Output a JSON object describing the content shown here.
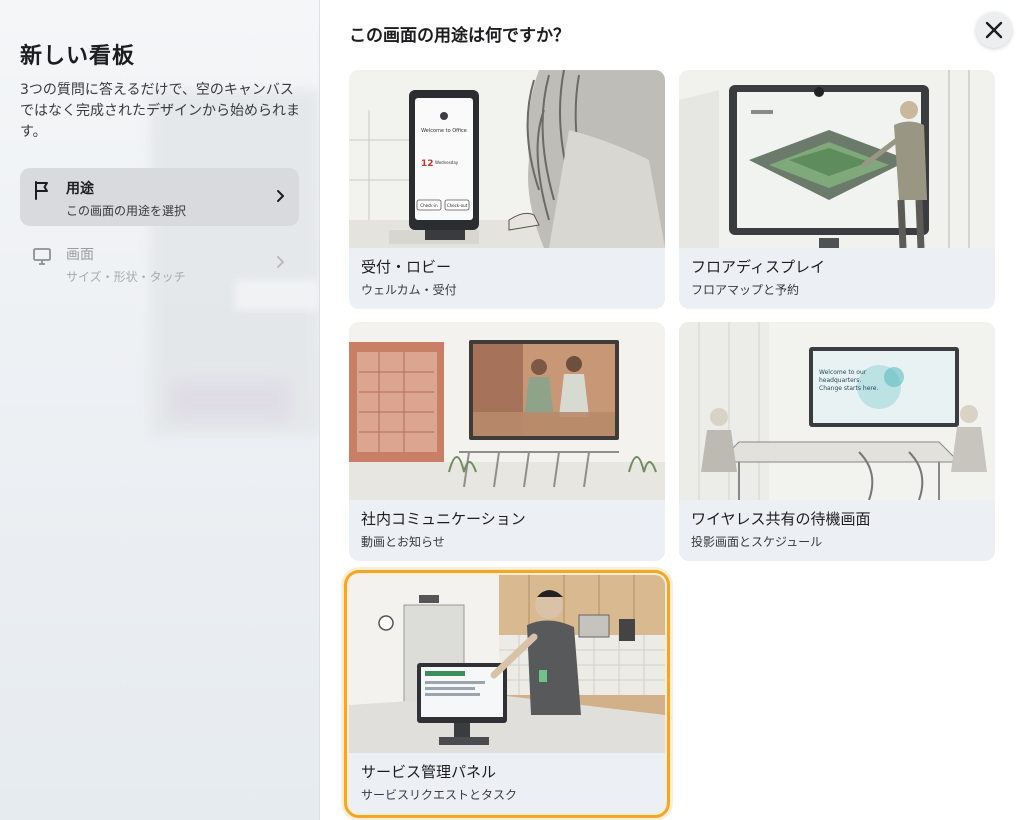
{
  "sidebar": {
    "title": "新しい看板",
    "description": "3つの質問に答えるだけで、空のキャンバスではなく完成されたデザインから始められます。",
    "steps": [
      {
        "label": "用途",
        "sub": "この画面の用途を選択",
        "icon": "flag-icon",
        "state": "active"
      },
      {
        "label": "画面",
        "sub": "サイズ・形状・タッチ",
        "icon": "monitor-icon",
        "state": "inactive"
      }
    ]
  },
  "main": {
    "title": "この画面の用途は何ですか？",
    "close_icon": "close-icon",
    "cards": [
      {
        "title": "受付・ロビー",
        "sub": "ウェルカム・受付",
        "kiosk_text": [
          "Welcome to Office",
          "12",
          "Wednesday",
          "Check-in",
          "Check-out"
        ]
      },
      {
        "title": "フロアディスプレイ",
        "sub": "フロアマップと予約"
      },
      {
        "title": "社内コミュニケーション",
        "sub": "動画とお知らせ"
      },
      {
        "title": "ワイヤレス共有の待機画面",
        "sub": "投影画面とスケジュール",
        "screen_text": [
          "Welcome to our",
          "headquarters.",
          "Change starts here."
        ]
      },
      {
        "title": "サービス管理パネル",
        "sub": "サービスリクエストとタスク",
        "selected": true
      }
    ]
  },
  "colors": {
    "accent": "#f5a623",
    "card_bg": "#eceff3",
    "active_step_bg": "#d8dadd"
  }
}
